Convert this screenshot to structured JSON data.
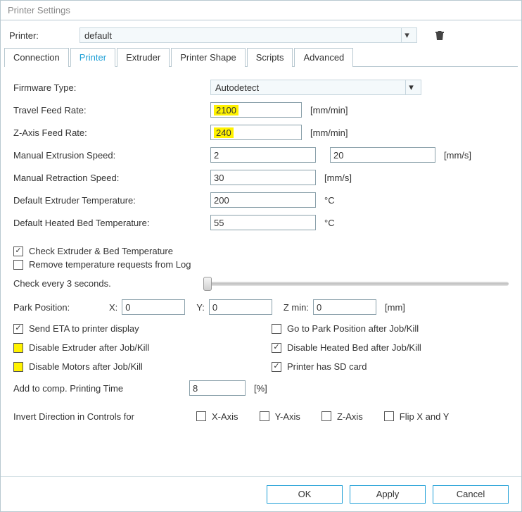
{
  "title": "Printer Settings",
  "printer_label": "Printer:",
  "printer_value": "default",
  "tabs": {
    "connection": "Connection",
    "printer": "Printer",
    "extruder": "Extruder",
    "shape": "Printer Shape",
    "scripts": "Scripts",
    "advanced": "Advanced"
  },
  "rows": {
    "firmware_label": "Firmware Type:",
    "firmware_value": "Autodetect",
    "travel_label": "Travel Feed Rate:",
    "travel_value": "2100",
    "travel_unit": "[mm/min]",
    "zfeed_label": "Z-Axis Feed Rate:",
    "zfeed_value": "240",
    "zfeed_unit": "[mm/min]",
    "mextr_label": "Manual Extrusion Speed:",
    "mextr_v1": "2",
    "mextr_v2": "20",
    "mextr_unit": "[mm/s]",
    "mretr_label": "Manual Retraction Speed:",
    "mretr_value": "30",
    "mretr_unit": "[mm/s]",
    "dext_label": "Default Extruder Temperature:",
    "dext_value": "200",
    "dext_unit": "°C",
    "dbed_label": "Default Heated Bed Temperature:",
    "dbed_value": "55",
    "dbed_unit": "°C"
  },
  "checks": {
    "check_temp": "Check Extruder & Bed Temperature",
    "remove_temp": "Remove temperature requests from Log",
    "slider_label": "Check every 3 seconds.",
    "send_eta": "Send ETA to printer display",
    "goto_park": "Go to Park Position after Job/Kill",
    "dis_extr": "Disable Extruder after Job/Kill",
    "dis_bed": "Disable Heated Bed after Job/Kill",
    "dis_motors": "Disable Motors after Job/Kill",
    "has_sd": "Printer has SD card"
  },
  "park": {
    "label": "Park Position:",
    "x": "X:",
    "xv": "0",
    "y": "Y:",
    "yv": "0",
    "z": "Z min:",
    "zv": "0",
    "unit": "[mm]"
  },
  "comp": {
    "label": "Add to comp. Printing Time",
    "value": "8",
    "unit": "[%]"
  },
  "invert": {
    "label": "Invert Direction in Controls for",
    "x": "X-Axis",
    "y": "Y-Axis",
    "z": "Z-Axis",
    "flip": "Flip X and Y"
  },
  "buttons": {
    "ok": "OK",
    "apply": "Apply",
    "cancel": "Cancel"
  },
  "checkmark": "✓"
}
